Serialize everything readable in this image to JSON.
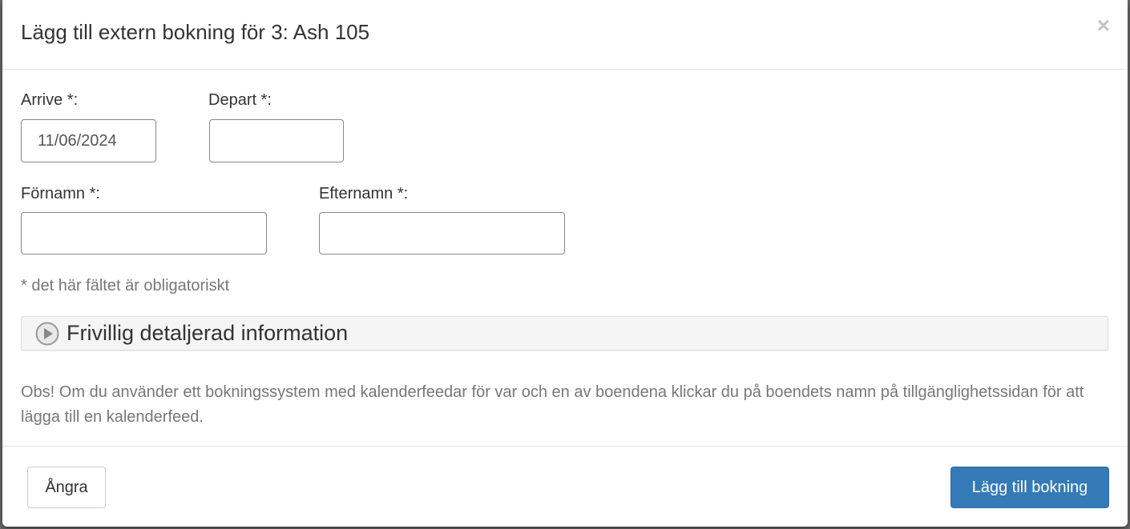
{
  "modal": {
    "title": "Lägg till extern bokning för 3: Ash 105",
    "close_glyph": "×"
  },
  "form": {
    "arrive": {
      "label": "Arrive *:",
      "value": "11/06/2024",
      "placeholder": ""
    },
    "depart": {
      "label": "Depart *:",
      "value": "",
      "placeholder": ""
    },
    "first_name": {
      "label": "Förnamn *:",
      "value": "",
      "placeholder": ""
    },
    "last_name": {
      "label": "Efternamn *:",
      "value": "",
      "placeholder": ""
    },
    "required_note": "* det här fältet är obligatoriskt"
  },
  "accordion": {
    "title": "Frivillig detaljerad information",
    "icon": "play-circle-icon",
    "expanded": false
  },
  "notice": {
    "text": "Obs! Om du använder ett bokningssystem med kalenderfeedar för var och en av boendena klickar du på boendets namn på tillgänglighetssidan för att lägga till en kalenderfeed."
  },
  "footer": {
    "cancel_label": "Ångra",
    "submit_label": "Lägg till bokning"
  },
  "colors": {
    "primary": "#337ab7",
    "text": "#333333",
    "muted": "#777777"
  }
}
